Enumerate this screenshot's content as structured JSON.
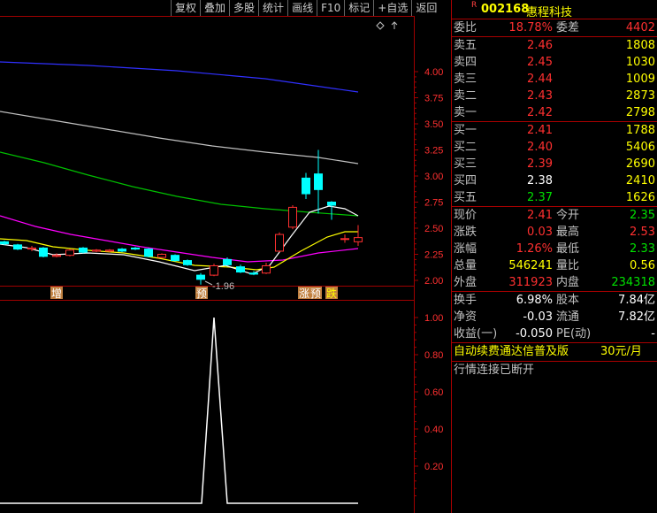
{
  "toolbar": {
    "items": [
      "复权",
      "叠加",
      "多股",
      "统计",
      "画线",
      "F10",
      "标记",
      "+自选",
      "返回"
    ]
  },
  "chart": {
    "price_axis": [
      "4.00",
      "3.75",
      "3.50",
      "3.25",
      "3.00",
      "2.75",
      "2.50",
      "2.25",
      "2.00"
    ],
    "vol_axis": [
      "1.00",
      "0.80",
      "0.60",
      "0.40",
      "0.20"
    ],
    "low_label": "1.96",
    "markers": [
      "增",
      "预",
      "涨",
      "跌"
    ],
    "colors": {
      "up": "#ff3030",
      "down": "#00ffff",
      "ma1": "#ffffff",
      "ma2": "#ffff00",
      "ma3": "#ff00ff",
      "ma4": "#00c000",
      "ma5": "#c0c0c0",
      "ma6": "#3030ff",
      "grid": "#a00000"
    }
  },
  "stock": {
    "r_mark": "R",
    "code": "002168",
    "name": "惠程科技"
  },
  "quote": {
    "weibi_label": "委比",
    "weibi": "18.78%",
    "weicha_label": "委差",
    "weicha": "4402",
    "asks": [
      {
        "label": "卖五",
        "price": "2.46",
        "vol": "1808"
      },
      {
        "label": "卖四",
        "price": "2.45",
        "vol": "1030"
      },
      {
        "label": "卖三",
        "price": "2.44",
        "vol": "1009"
      },
      {
        "label": "卖二",
        "price": "2.43",
        "vol": "2873"
      },
      {
        "label": "卖一",
        "price": "2.42",
        "vol": "2798"
      }
    ],
    "bids": [
      {
        "label": "买一",
        "price": "2.41",
        "vol": "1788"
      },
      {
        "label": "买二",
        "price": "2.40",
        "vol": "5406"
      },
      {
        "label": "买三",
        "price": "2.39",
        "vol": "2690"
      },
      {
        "label": "买四",
        "price": "2.38",
        "vol": "2410"
      },
      {
        "label": "买五",
        "price": "2.37",
        "vol": "1626"
      }
    ],
    "stats": [
      {
        "l1": "现价",
        "v1": "2.41",
        "c1": "red",
        "l2": "今开",
        "v2": "2.35",
        "c2": "grn"
      },
      {
        "l1": "涨跌",
        "v1": "0.03",
        "c1": "red",
        "l2": "最高",
        "v2": "2.53",
        "c2": "red"
      },
      {
        "l1": "涨幅",
        "v1": "1.26%",
        "c1": "red",
        "l2": "最低",
        "v2": "2.33",
        "c2": "grn"
      },
      {
        "l1": "总量",
        "v1": "546241",
        "c1": "yel",
        "l2": "量比",
        "v2": "0.56",
        "c2": "yel"
      },
      {
        "l1": "外盘",
        "v1": "311923",
        "c1": "red",
        "l2": "内盘",
        "v2": "234318",
        "c2": "grn"
      }
    ],
    "fin": [
      {
        "l1": "换手",
        "v1": "6.98%",
        "l2": "股本",
        "v2": "7.84亿"
      },
      {
        "l1": "净资",
        "v1": "-0.03",
        "l2": "流通",
        "v2": "7.82亿"
      },
      {
        "l1": "收益(一)",
        "v1": "-0.050",
        "l2": "PE(动)",
        "v2": "-"
      }
    ]
  },
  "ad": {
    "text": "自动续费通达信普及版",
    "price": "30元/月"
  },
  "status": "行情连接已断开"
}
